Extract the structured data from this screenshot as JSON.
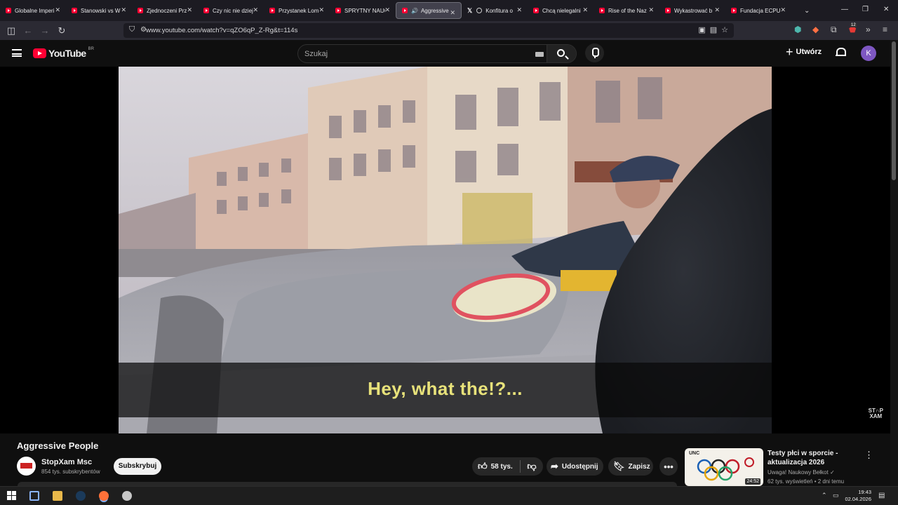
{
  "browser": {
    "tabs": [
      {
        "title": "Globalne Imperi",
        "icon": "youtube-icon"
      },
      {
        "title": "Stanowski vs W",
        "icon": "youtube-icon"
      },
      {
        "title": "Zjednoczeni Prz",
        "icon": "youtube-icon"
      },
      {
        "title": "Czy nic nie dziej",
        "icon": "youtube-icon"
      },
      {
        "title": "Przystanek Lom",
        "icon": "youtube-icon"
      },
      {
        "title": "SPRYTNY NAUC",
        "icon": "youtube-icon"
      },
      {
        "title": "Aggressive",
        "icon": "youtube-icon",
        "active": true,
        "audio": true
      },
      {
        "title": "Konfitura o",
        "icon": "x-icon"
      },
      {
        "title": "Chcą nielegalni",
        "icon": "youtube-icon"
      },
      {
        "title": "Rise of the Naz",
        "icon": "youtube-icon"
      },
      {
        "title": "Wykastrować b",
        "icon": "youtube-icon"
      },
      {
        "title": "Fundacja ECPU",
        "icon": "youtube-icon"
      }
    ],
    "url": "www.youtube.com/watch?v=qZO6qP_Z-Rg&t=114s",
    "extension_badge": "12"
  },
  "youtube": {
    "logo_text": "YouTube",
    "country_code": "BR",
    "search_placeholder": "Szukaj",
    "create_label": "Utwórz",
    "avatar_letter": "K"
  },
  "video": {
    "subtitle": "Hey, what the!?...",
    "watermark_top": "ST∩P",
    "watermark_bottom": "XAM",
    "title": "Aggressive People",
    "channel_name": "StopXam Msc",
    "channel_subs": "854 tys. subskrybentów",
    "subscribe_label": "Subskrybuj",
    "likes": "58 tys.",
    "share_label": "Udostępnij",
    "save_label": "Zapisz"
  },
  "recommendation": {
    "title": "Testy płci w sporcie - aktualizacja 2026",
    "channel": "Uwaga! Naukowy Bełkot",
    "meta": "62 tys. wyświetleń • 2 dni temu",
    "duration": "24:52",
    "thumb_logo": "UNC"
  },
  "taskbar": {
    "time": "19:43",
    "date": "02.04.2026"
  },
  "colors": {
    "youtube_red": "#ff0033",
    "subtitle_yellow": "#e8e27a",
    "avatar_purple": "#7e57c2"
  }
}
